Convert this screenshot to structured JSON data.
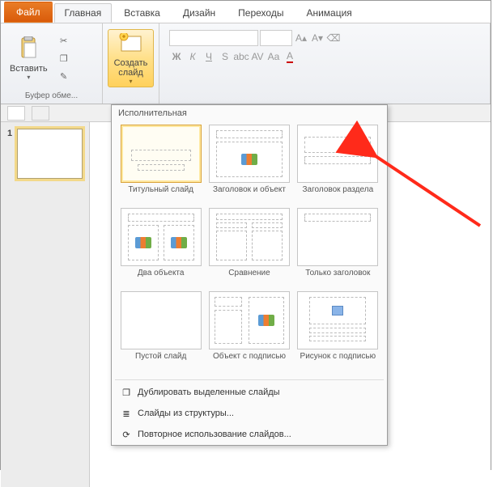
{
  "tabs": {
    "file": "Файл",
    "home": "Главная",
    "insert": "Вставка",
    "design": "Дизайн",
    "transitions": "Переходы",
    "animation": "Анимация"
  },
  "ribbon": {
    "clipboard": {
      "paste": "Вставить",
      "label": "Буфер обме..."
    },
    "slides": {
      "new_slide": "Создать слайд"
    }
  },
  "thumb": {
    "num": "1"
  },
  "dropdown": {
    "section": "Исполнительная",
    "layouts": [
      "Титульный слайд",
      "Заголовок и объект",
      "Заголовок раздела",
      "Два объекта",
      "Сравнение",
      "Только заголовок",
      "Пустой слайд",
      "Объект с подписью",
      "Рисунок с подписью"
    ],
    "actions": {
      "duplicate": "Дублировать выделенные слайды",
      "outline": "Слайды из структуры...",
      "reuse": "Повторное использование слайдов..."
    }
  }
}
